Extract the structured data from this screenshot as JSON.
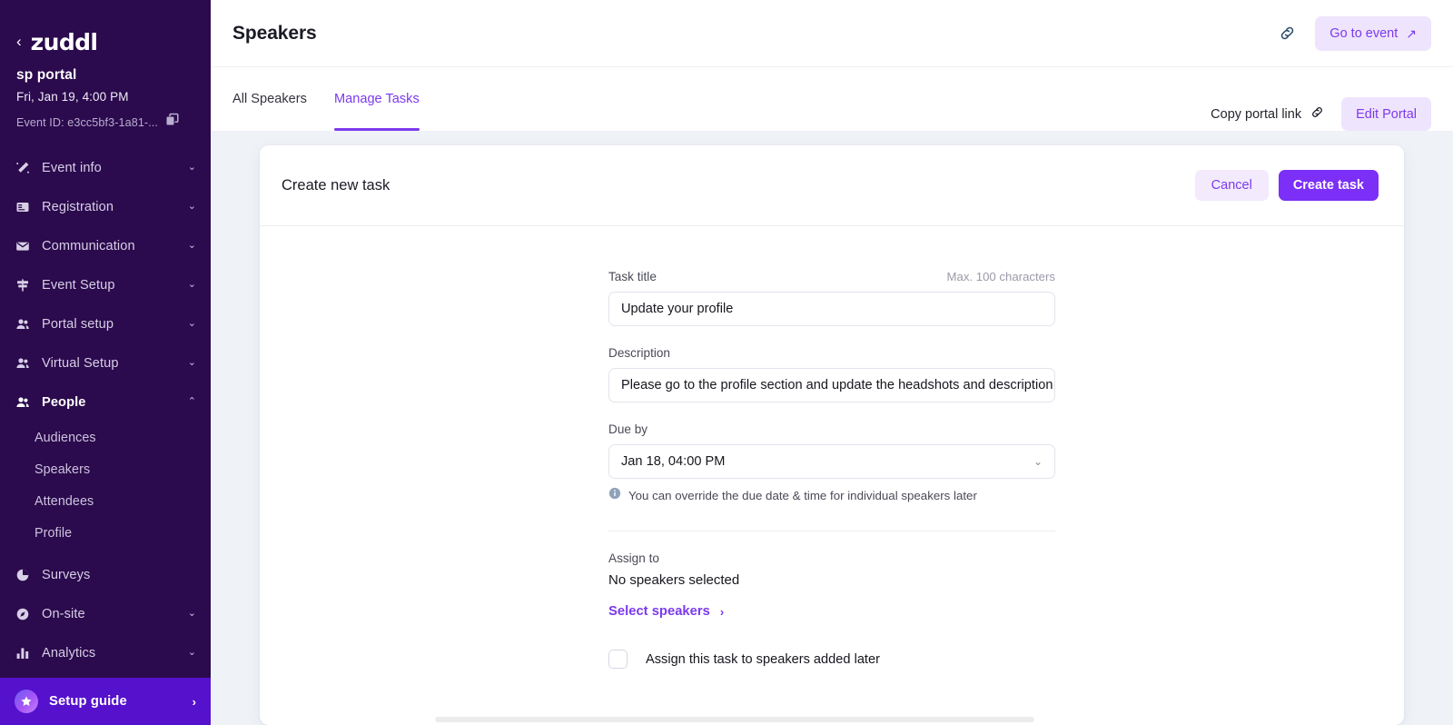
{
  "sidebar": {
    "brand": {
      "back_icon": "chevron-left-icon",
      "logo_text": "zuddl"
    },
    "event": {
      "name": "sp portal",
      "date": "Fri, Jan 19, 4:00 PM",
      "event_id_label": "Event ID: e3cc5bf3-1a81-...",
      "copy_icon": "copy-icon"
    },
    "nav": [
      {
        "label": "Event info",
        "icon": "magic-wand-icon",
        "chevron": "⌄",
        "active": false
      },
      {
        "label": "Registration",
        "icon": "form-icon",
        "chevron": "⌄",
        "active": false
      },
      {
        "label": "Communication",
        "icon": "envelope-icon",
        "chevron": "⌄",
        "active": false
      },
      {
        "label": "Event Setup",
        "icon": "signpost-icon",
        "chevron": "⌄",
        "active": false
      },
      {
        "label": "Portal setup",
        "icon": "people-icon",
        "chevron": "⌄",
        "active": false
      },
      {
        "label": "Virtual Setup",
        "icon": "people-icon",
        "chevron": "⌄",
        "active": false
      },
      {
        "label": "People",
        "icon": "people-icon",
        "chevron": "⌃",
        "active": true
      },
      {
        "label": "Surveys",
        "icon": "pie-chart-icon",
        "chevron": "",
        "active": false
      },
      {
        "label": "On-site",
        "icon": "compass-icon",
        "chevron": "⌄",
        "active": false
      },
      {
        "label": "Analytics",
        "icon": "bar-chart-icon",
        "chevron": "⌄",
        "active": false
      }
    ],
    "people_subitems": [
      {
        "label": "Audiences"
      },
      {
        "label": "Speakers"
      },
      {
        "label": "Attendees"
      },
      {
        "label": "Profile"
      }
    ],
    "setup_guide": {
      "label": "Setup guide",
      "icon": "star-icon",
      "chevron": "›"
    }
  },
  "topbar": {
    "title": "Speakers",
    "link_icon": "link-icon",
    "go_to_event_label": "Go to event",
    "go_to_event_icon": "arrow-up-right-icon"
  },
  "tabbar": {
    "tabs": [
      {
        "label": "All Speakers",
        "active": false
      },
      {
        "label": "Manage Tasks",
        "active": true
      }
    ],
    "copy_portal_link_label": "Copy portal link",
    "copy_portal_link_icon": "link-icon",
    "edit_portal_label": "Edit Portal"
  },
  "card": {
    "title": "Create new task",
    "cancel_label": "Cancel",
    "create_label": "Create task"
  },
  "form": {
    "task_title": {
      "label": "Task title",
      "hint": "Max. 100 characters",
      "value": "Update your profile"
    },
    "description": {
      "label": "Description",
      "value": "Please go to the profile section and update the headshots and description"
    },
    "due_by": {
      "label": "Due by",
      "value": "Jan 18, 04:00 PM",
      "chevron_icon": "chevron-down-icon",
      "note_icon": "info-icon",
      "note": "You can override the due date & time for individual speakers later"
    },
    "assign_to": {
      "label": "Assign to",
      "value": "No speakers selected",
      "select_speakers_label": "Select speakers",
      "select_speakers_icon": "chevron-right-icon"
    },
    "assign_later": {
      "label": "Assign this task to speakers added later",
      "checked": false
    }
  },
  "colors": {
    "sidebar_bg": "#2b0a4d",
    "accent_purple": "#7c3aed",
    "primary_button": "#7b2ff7",
    "page_bg": "#eff2f7",
    "setup_guide_bg": "#5511cc"
  }
}
